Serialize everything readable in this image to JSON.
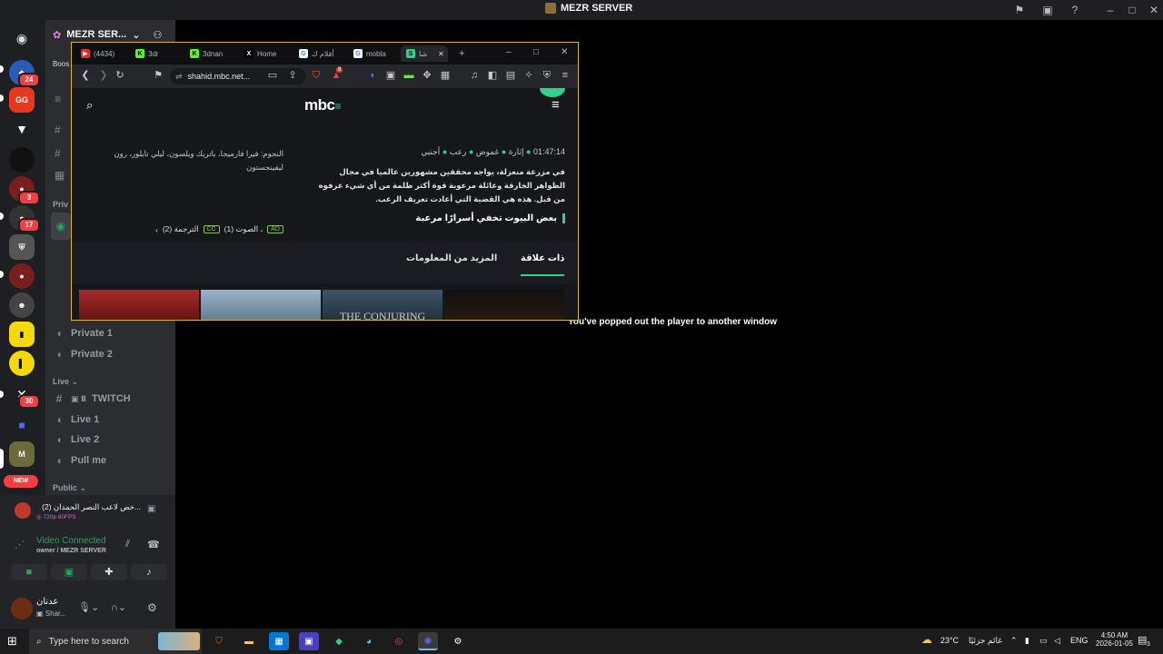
{
  "titlebar": {
    "title": "MEZR SERVER"
  },
  "server_rail": {
    "badges": [
      "24",
      "3",
      "17",
      "30"
    ],
    "gg_label": "GG",
    "new_label": "NEW"
  },
  "sidebar": {
    "server_name": "MEZR SER...",
    "boost_label": "Boos",
    "private_label": "Priv",
    "channels_private": [
      "Private 1",
      "Private 2"
    ],
    "live_category": "Live",
    "live_channels": {
      "twitch": "TWITCH",
      "live1": "Live 1",
      "live2": "Live 2",
      "pullme": "Pull me"
    },
    "public_category": "Public"
  },
  "voice_panel": {
    "stream_title": "...خص لاعب النصر الحمدان (2)",
    "stream_quality": "720p 60FPS",
    "status": "Video Connected",
    "location": "owner / MEZR SERVER"
  },
  "user_panel": {
    "name": "عدنان",
    "status": "Shar..."
  },
  "main": {
    "popout_message": "You've popped out the player to another window"
  },
  "browser": {
    "tabs": [
      {
        "label": "(4434)",
        "fav": "▶",
        "color": "#e02f2f"
      },
      {
        "label": "3dr",
        "fav": "K",
        "color": "#53fc18"
      },
      {
        "label": "3dnan",
        "fav": "K",
        "color": "#53fc18"
      },
      {
        "label": "Home",
        "fav": "X",
        "color": "#000000"
      },
      {
        "label": "أفلام ك",
        "fav": "G",
        "color": "#ffffff"
      },
      {
        "label": "mobla",
        "fav": "G",
        "color": "#ffffff"
      },
      {
        "label": "شا",
        "fav": "S",
        "color": "#2fd28d"
      }
    ],
    "new_tab": "+",
    "url": "shahid.mbc.net...",
    "brave_badge": "9"
  },
  "shahid": {
    "logo": "mbc",
    "duration": "01:47:14",
    "genres": [
      "إثارة",
      "غموض",
      "رعب",
      "أجنبي"
    ],
    "description": "في مزرعة منعزلة، يواجه محققين مشهورين عالميا في مجال الظواهر الخارقة وعائلة مرعوبة قوة أكثر ظلمة من أي شيء عرفوه من قبل. هذه هي القضية التي أعادت تعريف الرعب.",
    "tagline": "بعض البيوت تخفي أسرارًا مرعبة",
    "cast": "النجوم: فيرا فارميجا، باتريك ويلسون، ليلي تايلور، رون ليفينجستون",
    "audio": "الصوت (1) ،",
    "subtitles": "الترجمة (2)",
    "ad_tag": "AD",
    "cc_tag": "CC",
    "tab_related": "ذات علاقة",
    "tab_more": "المزيد من المعلومات",
    "thumb_text": "THE CONJURING"
  },
  "taskbar": {
    "search_placeholder": "Type here to search",
    "weather_temp": "23°C",
    "weather_desc": "غائم جزئيًا",
    "lang": "ENG",
    "time": "4:50 AM",
    "date": "2026-01-05",
    "notif_count": "3"
  }
}
